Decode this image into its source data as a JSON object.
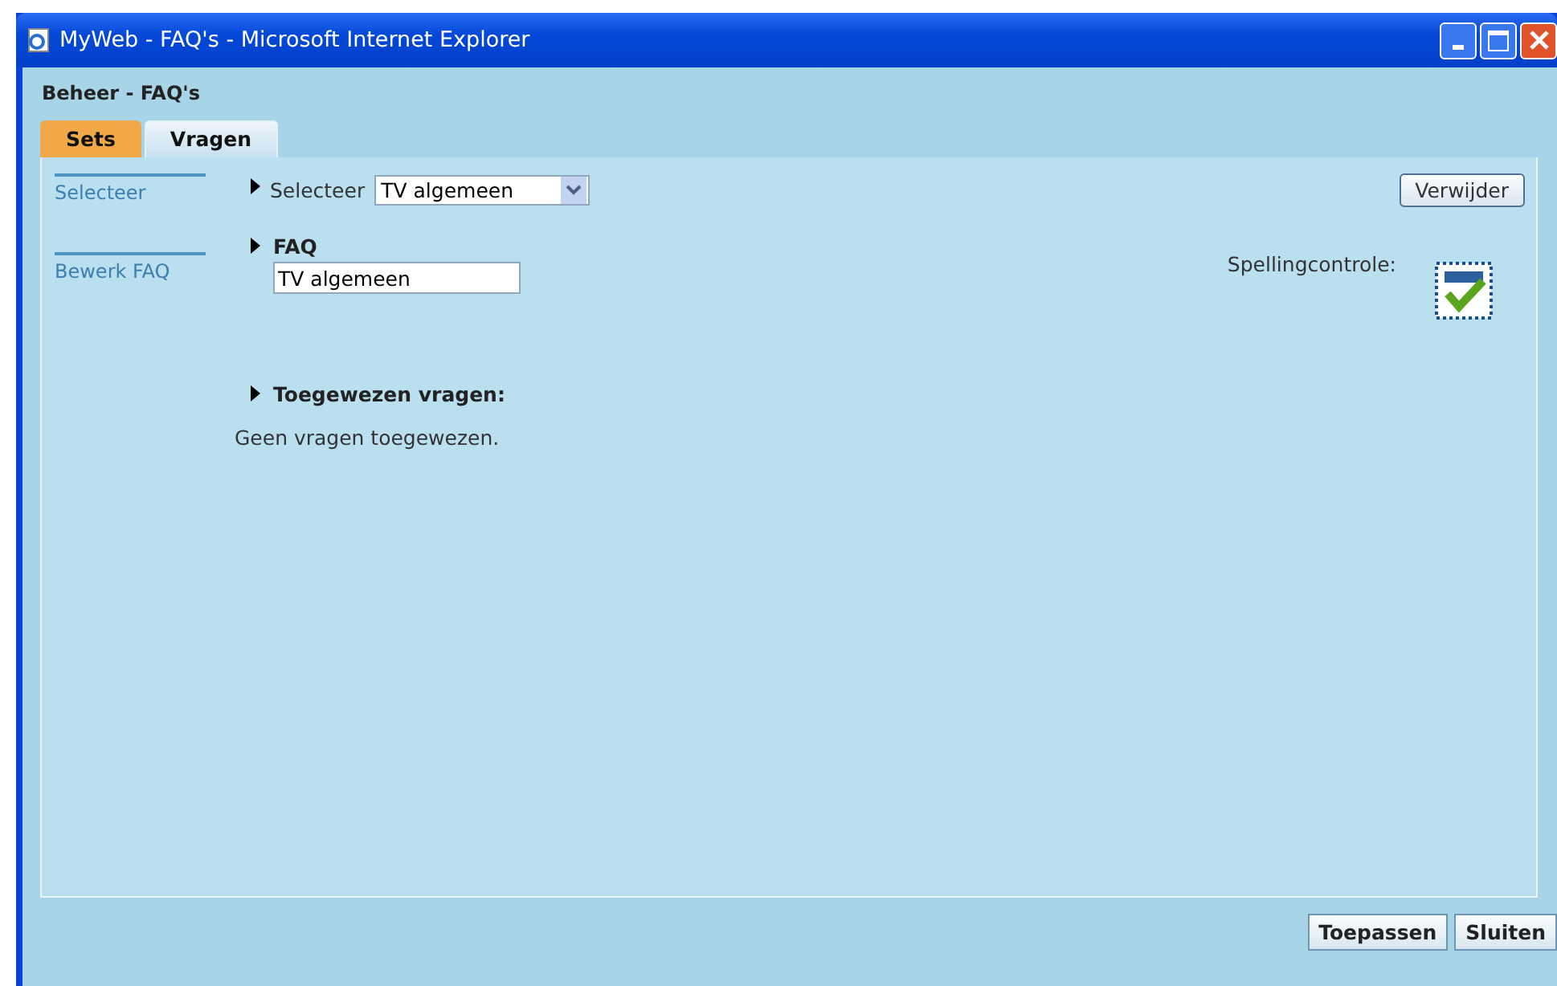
{
  "window": {
    "title": "MyWeb - FAQ's - Microsoft Internet Explorer"
  },
  "page_title": "Beheer - FAQ's",
  "tabs": [
    {
      "label": "Sets",
      "selected": true
    },
    {
      "label": "Vragen",
      "selected": false
    }
  ],
  "sidebar": {
    "items": [
      {
        "label": "Selecteer"
      },
      {
        "label": "Bewerk FAQ"
      }
    ]
  },
  "select_section": {
    "label": "Selecteer",
    "value": "TV algemeen",
    "delete_button": "Verwijder"
  },
  "faq_section": {
    "heading": "FAQ",
    "value": "TV algemeen",
    "spellcheck_label": "Spellingcontrole:"
  },
  "assigned_section": {
    "heading": "Toegewezen vragen:",
    "message": "Geen vragen toegewezen."
  },
  "buttons": [
    "Toepassen",
    "Sluiten"
  ]
}
